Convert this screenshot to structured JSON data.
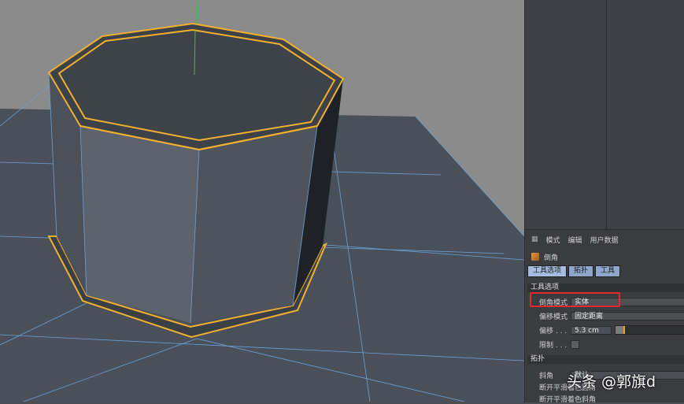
{
  "attributes_panel": {
    "menu": [
      "模式",
      "编辑",
      "用户数据"
    ],
    "object_name": "倒角",
    "tabs": [
      "工具选项",
      "拓扑",
      "工具"
    ],
    "section_tool_options": "工具选项",
    "bevel_mode_label": "倒角模式",
    "bevel_mode_value": "实体",
    "offset_mode_label": "偏移模式",
    "offset_mode_value": "固定距离",
    "offset_label": "偏移 . . .",
    "offset_value": "5.3 cm",
    "offset_slider_level": 0.12,
    "limit_label": "限制 . . .",
    "section_topology": "拓扑",
    "miter_label": "斜角",
    "miter_value": "默认",
    "break_smooth_label": "断开平滑着色圆角",
    "break_smooth2_label": "断开平滑着色斜角"
  },
  "watermark": "头条 @郭旗d",
  "colors": {
    "viewport_bg": "#8a8a8a",
    "floor": "#4a5059",
    "selected_edges": "#f0b030",
    "grid_lines": "#6aa0d6",
    "highlight_box": "#e22b2b"
  }
}
